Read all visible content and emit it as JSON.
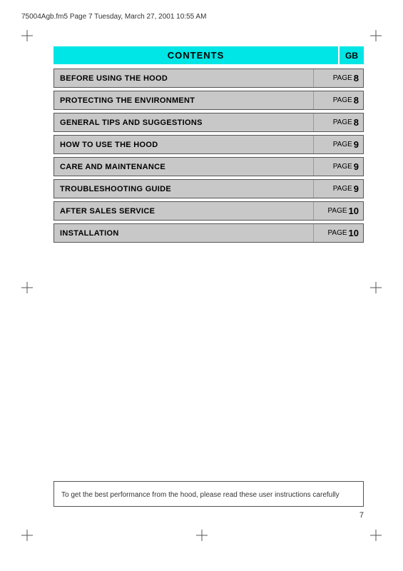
{
  "header": {
    "filename": "75004Agb.fm5  Page 7  Tuesday, March 27, 2001  10:55 AM"
  },
  "contents": {
    "title": "CONTENTS",
    "gb_label": "GB"
  },
  "rows": [
    {
      "label": "BEFORE USING THE HOOD",
      "page_word": "PAGE",
      "page_num": "8"
    },
    {
      "label": "PROTECTING THE ENVIRONMENT",
      "page_word": "PAGE",
      "page_num": "8"
    },
    {
      "label": "GENERAL TIPS AND SUGGESTIONS",
      "page_word": "PAGE",
      "page_num": "8"
    },
    {
      "label": "HOW TO USE THE HOOD",
      "page_word": "PAGE",
      "page_num": "9"
    },
    {
      "label": "CARE AND MAINTENANCE",
      "page_word": "PAGE",
      "page_num": "9"
    },
    {
      "label": "TROUBLESHOOTING GUIDE",
      "page_word": "PAGE",
      "page_num": "9"
    },
    {
      "label": "AFTER SALES SERVICE",
      "page_word": "PAGE",
      "page_num": "10"
    },
    {
      "label": "INSTALLATION",
      "page_word": "PAGE",
      "page_num": "10"
    }
  ],
  "bottom_note": "To get the best performance from the hood, please read these user instructions carefully",
  "page_number": "7"
}
